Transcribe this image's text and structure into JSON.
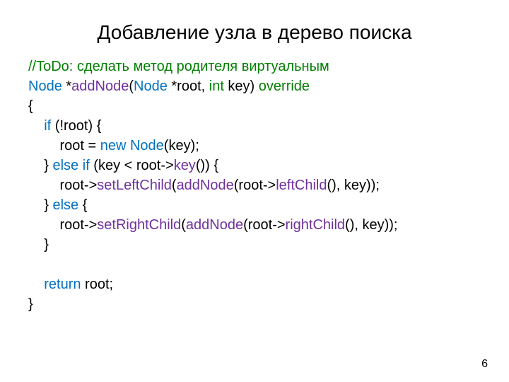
{
  "title": "Добавление узла в дерево поиска",
  "code": {
    "comment": "//ToDo: сделать метод родителя виртуальным",
    "sig": {
      "Node": "Node",
      "star": " *",
      "addNode": "addNode",
      "open": "(",
      "Node2": "Node",
      "root_param": " *root, ",
      "int": "int",
      "key_param": " key) ",
      "override": "override"
    },
    "l_open_brace": "{",
    "l_if": {
      "indent": "    ",
      "if": "if",
      "rest": " (!root) {"
    },
    "l_new": {
      "indent": "        ",
      "pre": "root = ",
      "new": "new",
      "sp": " ",
      "Node": "Node",
      "rest": "(key);"
    },
    "l_elseif": {
      "indent": "    ",
      "close": "} ",
      "else": "else",
      "sp": " ",
      "if": "if",
      "mid": " (key < root->",
      "key": "key",
      "rest": "()) {"
    },
    "l_left": {
      "indent": "        ",
      "pre": "root->",
      "setLeft": "setLeftChild",
      "open": "(",
      "addNode": "addNode",
      "mid": "(root->",
      "leftChild": "leftChild",
      "rest": "(), key));"
    },
    "l_else": {
      "indent": "    ",
      "close": "} ",
      "else": "else",
      "rest": " {"
    },
    "l_right": {
      "indent": "        ",
      "pre": "root->",
      "setRight": "setRightChild",
      "open": "(",
      "addNode": "addNode",
      "mid": "(root->",
      "rightChild": "rightChild",
      "rest": "(), key));"
    },
    "l_close_inner": "    }",
    "l_blank": "",
    "l_return": {
      "indent": "    ",
      "return": "return",
      "rest": " root;"
    },
    "l_close_brace": "}"
  },
  "page_number": "6"
}
